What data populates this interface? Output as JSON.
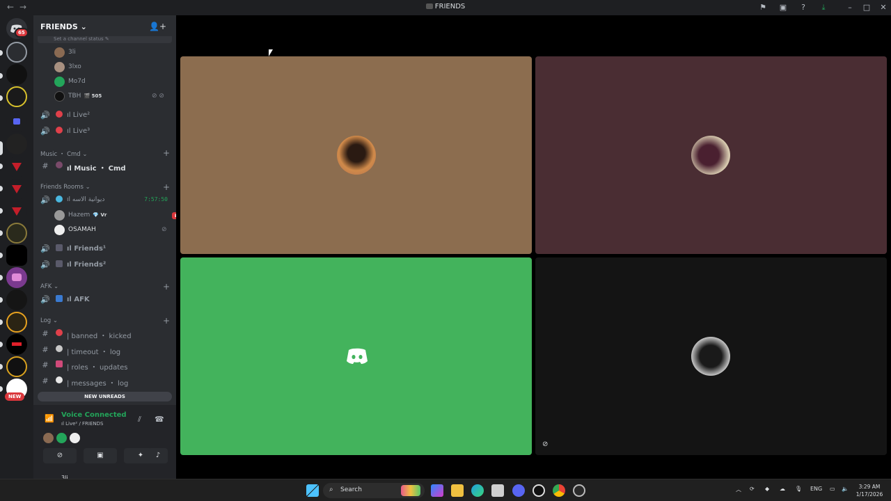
{
  "window": {
    "title": "FRIENDS",
    "back_icon": "arrow-left-icon",
    "forward_icon": "arrow-right-icon"
  },
  "rail": {
    "home_badge": "65",
    "new_badge": "NEW"
  },
  "guild": {
    "name": "FRIENDS ⌄",
    "status_hint": "Set a channel status ✎"
  },
  "voice_members_top": [
    {
      "name": "3li"
    },
    {
      "name": "3lxo"
    },
    {
      "name": "Mo7d"
    },
    {
      "name": "TBH",
      "tag": "🎬 505"
    }
  ],
  "channels_top": [
    {
      "label": "ıl Live²"
    },
    {
      "label": "ıl Live³"
    }
  ],
  "categories": {
    "music": "Music ・ Cmd ⌄",
    "friends_rooms": "Friends Rooms ⌄",
    "afk": "AFK ⌄",
    "log": "Log ⌄"
  },
  "music_channel": "ıl Music ・ Cmd",
  "friends_voice": {
    "label": "ıl ديوانية الاسه",
    "timer": "7:57:50",
    "members": [
      {
        "name": "Hazem",
        "tag": "💎 Vr",
        "badge": "LIVE"
      },
      {
        "name": "OSAMAH"
      }
    ],
    "rooms": [
      "ıl Friends¹",
      "ıl Friends²"
    ]
  },
  "afk_channel": "ıl AFK",
  "log_channels": [
    "| banned ・ kicked",
    "| timeout ・ log",
    "| roles ・ updates",
    "| messages ・ log"
  ],
  "new_unreads": "NEW UNREADS",
  "voice_panel": {
    "status": "Voice Connected",
    "channel": "ıl Live² / FRIENDS"
  },
  "user_footer": "3li",
  "taskbar": {
    "search_label": "Search",
    "lang": "ENG",
    "time": "3:29 AM",
    "date": "1/17/2026"
  },
  "colors": {
    "tile1": "#8c6d4f",
    "tile2": "#4a2d33",
    "tile3": "#43b35c",
    "tile4": "#141414",
    "accent_green": "#23a55a",
    "danger": "#da373c"
  }
}
